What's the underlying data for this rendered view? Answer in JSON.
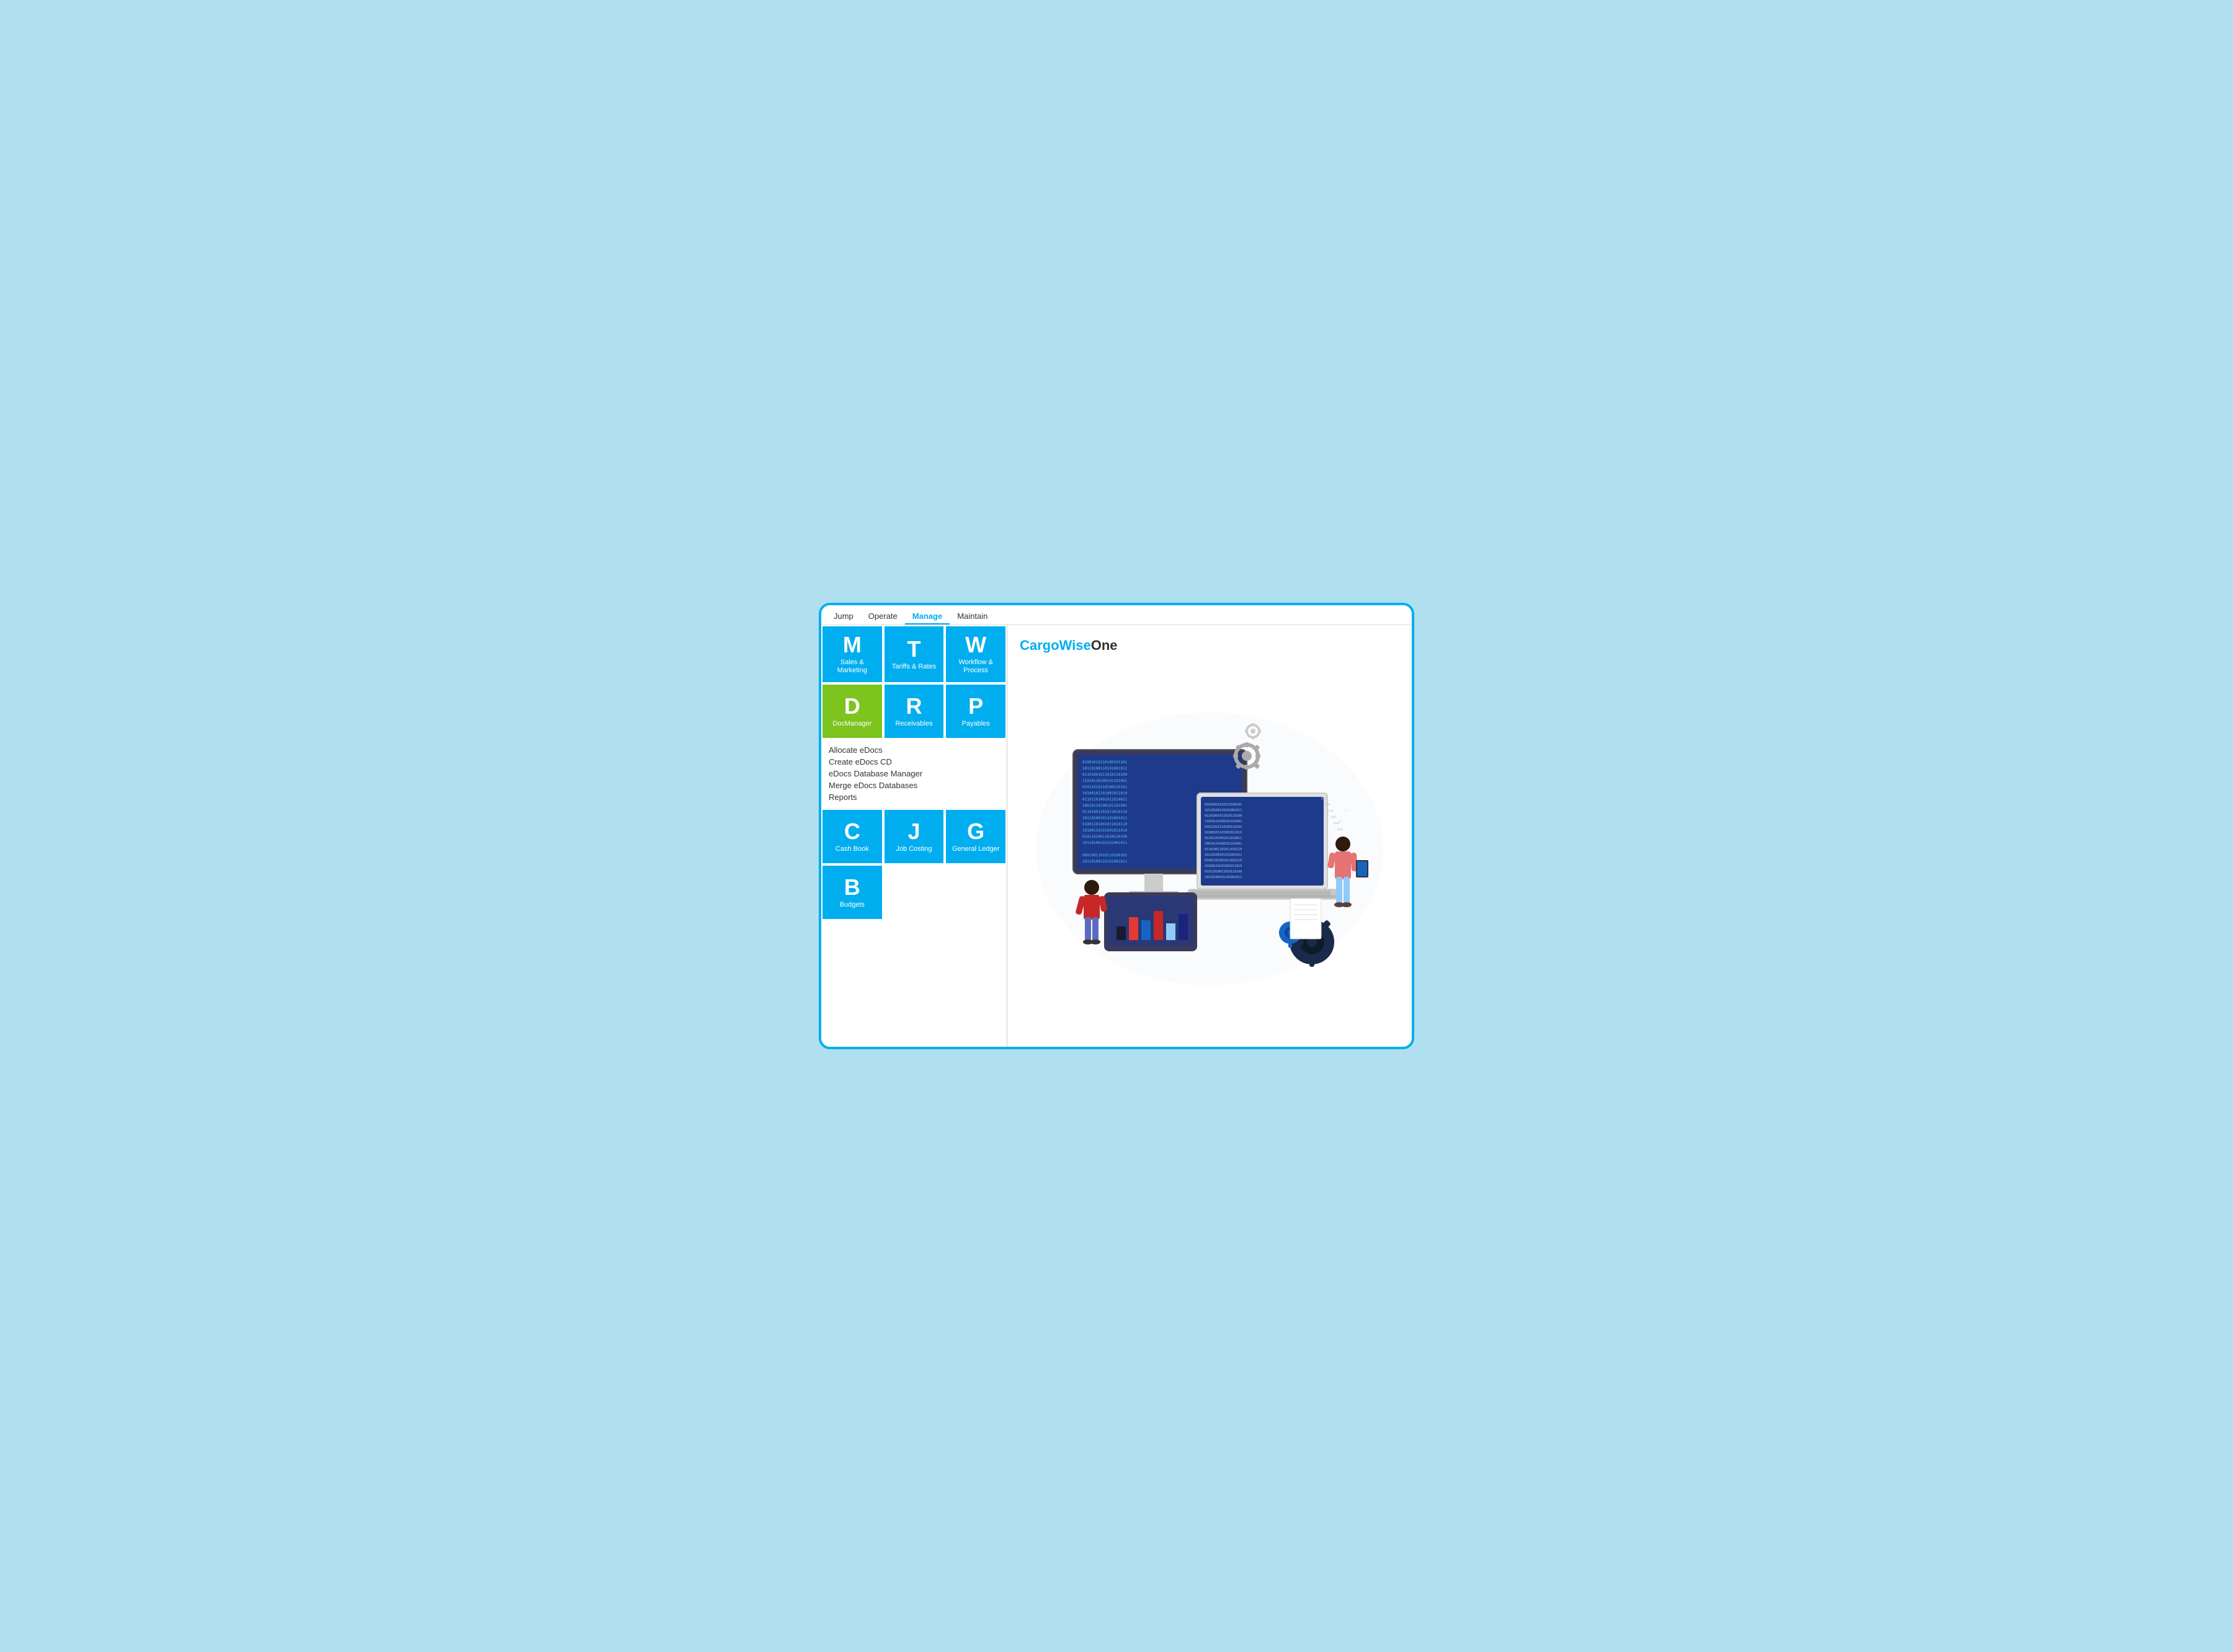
{
  "menu": {
    "items": [
      {
        "label": "Jump",
        "active": false
      },
      {
        "label": "Operate",
        "active": false
      },
      {
        "label": "Manage",
        "active": true
      },
      {
        "label": "Maintain",
        "active": false
      }
    ]
  },
  "brand": {
    "cargo": "CargoWise",
    "one": "One"
  },
  "top_tiles": [
    {
      "letter": "M",
      "label": "Sales &\nMarketing",
      "color": "blue"
    },
    {
      "letter": "T",
      "label": "Tariffs & Rates",
      "color": "blue"
    },
    {
      "letter": "W",
      "label": "Workflow &\nProcess",
      "color": "blue"
    },
    {
      "letter": "D",
      "label": "DocManager",
      "color": "green"
    },
    {
      "letter": "R",
      "label": "Receivables",
      "color": "blue"
    },
    {
      "letter": "P",
      "label": "Payables",
      "color": "blue"
    }
  ],
  "dropdown": {
    "items": [
      "Allocate eDocs",
      "Create eDocs CD",
      "eDocs Database Manager",
      "Merge eDocs Databases",
      "Reports"
    ]
  },
  "bottom_tiles": [
    {
      "letter": "C",
      "label": "Cash Book",
      "color": "blue"
    },
    {
      "letter": "J",
      "label": "Job Costing",
      "color": "blue"
    },
    {
      "letter": "G",
      "label": "General Ledger",
      "color": "blue"
    }
  ],
  "budget_tile": {
    "letter": "B",
    "label": "Budgets",
    "color": "blue"
  }
}
